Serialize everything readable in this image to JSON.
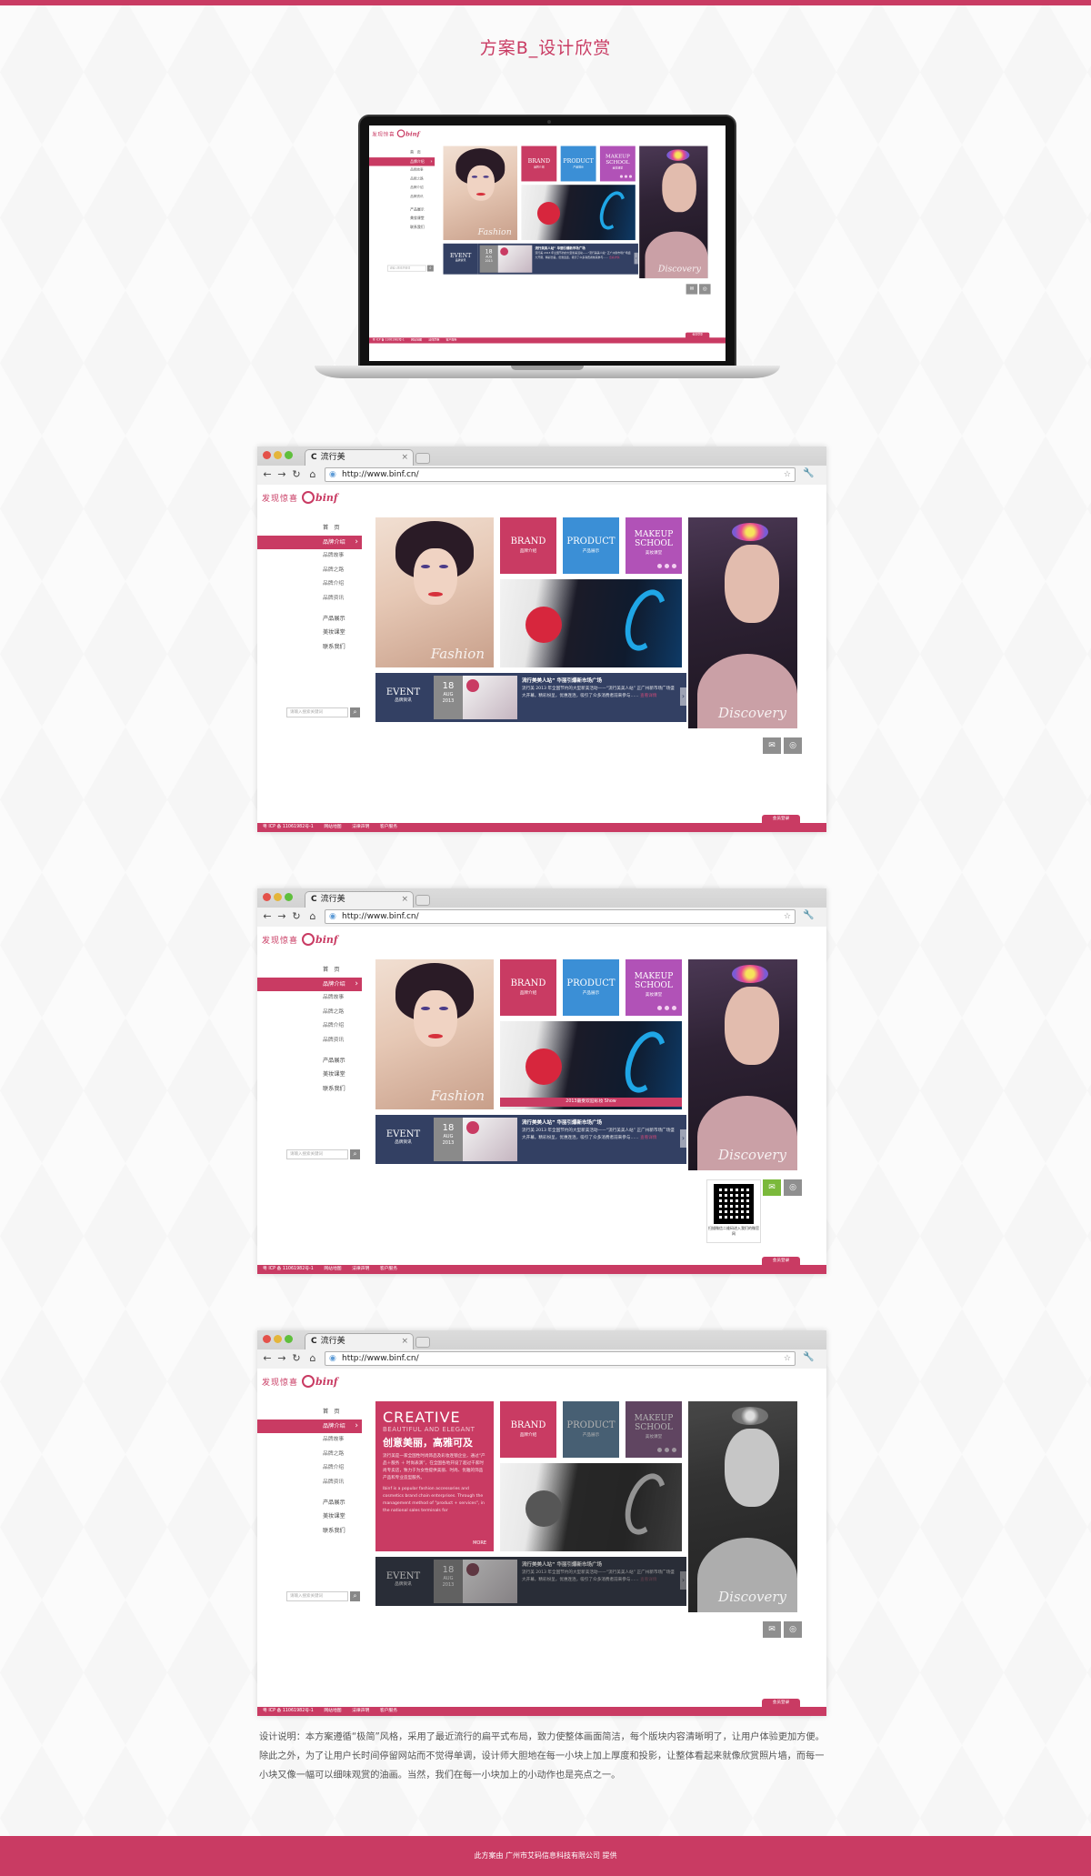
{
  "page": {
    "title": "方案B_设计欣赏",
    "description": "设计说明：本方案遵循“极简”风格，采用了最近流行的扁平式布局，致力使整体画面简洁，每个版块内容清晰明了，让用户体验更加方便。除此之外，为了让用户长时间停留网站而不觉得单调，设计师大胆地在每一小块上加上厚度和投影，让整体看起来就像欣赏照片墙，而每一小块又像一幅可以细味观赏的油画。当然，我们在每一小块加上的小动作也是亮点之一。",
    "footer": "此方案由 广州市艾码信息科技有限公司 提供",
    "colors": {
      "accent": "#c93b63",
      "blue": "#3b8fd6",
      "purple": "#b152b7",
      "navy": "#334063"
    }
  },
  "browser": {
    "tab_title": "流行美",
    "url": "http://www.binf.cn/",
    "icons": [
      "back-icon",
      "forward-icon",
      "reload-icon",
      "home-icon",
      "globe-icon",
      "star-icon",
      "wrench-icon"
    ]
  },
  "site": {
    "logo_cn": "发现惊喜",
    "logo_mark": "binf",
    "nav": [
      {
        "label": "首　页"
      },
      {
        "label": "品牌介绍"
      },
      {
        "label": "品牌故事"
      },
      {
        "label": "品牌之路"
      },
      {
        "label": "品牌介绍"
      },
      {
        "label": "品牌资讯"
      },
      {
        "label": "产品展示"
      },
      {
        "label": "美妆课堂"
      },
      {
        "label": "联系我们"
      }
    ],
    "search_placeholder": "请输入搜索关键词",
    "tiles": {
      "fashion": "Fashion",
      "brand": {
        "title": "BRAND",
        "sub": "品牌介绍"
      },
      "product": {
        "title": "PRODUCT",
        "sub": "产品展示"
      },
      "makeup": {
        "title": "MAKEUP SCHOOL",
        "sub": "美妆课堂"
      },
      "discovery": "Discovery",
      "event": {
        "title": "EVENT",
        "sub": "品牌资讯"
      },
      "date": {
        "day": "18",
        "month": "AUG",
        "year": "2013"
      },
      "news": {
        "headline": "流行美美人站” 华丽引爆新市场广场",
        "body": "流行美 2013 年全国节约的大型新美活动——“流行美美人站” 正广州新市场广场盛大开幕，精彩纷呈，优惠连连，吸引了众多消费者前来参与……",
        "more": "查看详情"
      },
      "photo_caption": "2013最受欢迎彩妆 Show"
    },
    "creative": {
      "heading": "CREATIVE",
      "sub": "BEAUTIFUL AND ELEGANT",
      "cn": "创意美丽，高雅可及",
      "body_cn": "流行美是一家全国性时尚饰品及彩妆连锁企业，通过“产品＋服务 ＋ 时尚表演”，在全国各地开设了超过千家时尚专卖店，致力于为女性提供美丽、时尚、优雅的饰品产品和专业造型服务。",
      "body_en": "Ibinf is a popular fashion accessories and cosmetics brand chain enterprises. Through the management method of \"product + services\", in the national sales terminals for",
      "more": "MORE"
    },
    "qr_text": "扫描微信二维码进入我们的微官网",
    "member_label": "会员登录",
    "footer": [
      "粤 ICP 备 11061982号-1",
      "网站地图",
      "法律声明",
      "客户服务"
    ]
  }
}
